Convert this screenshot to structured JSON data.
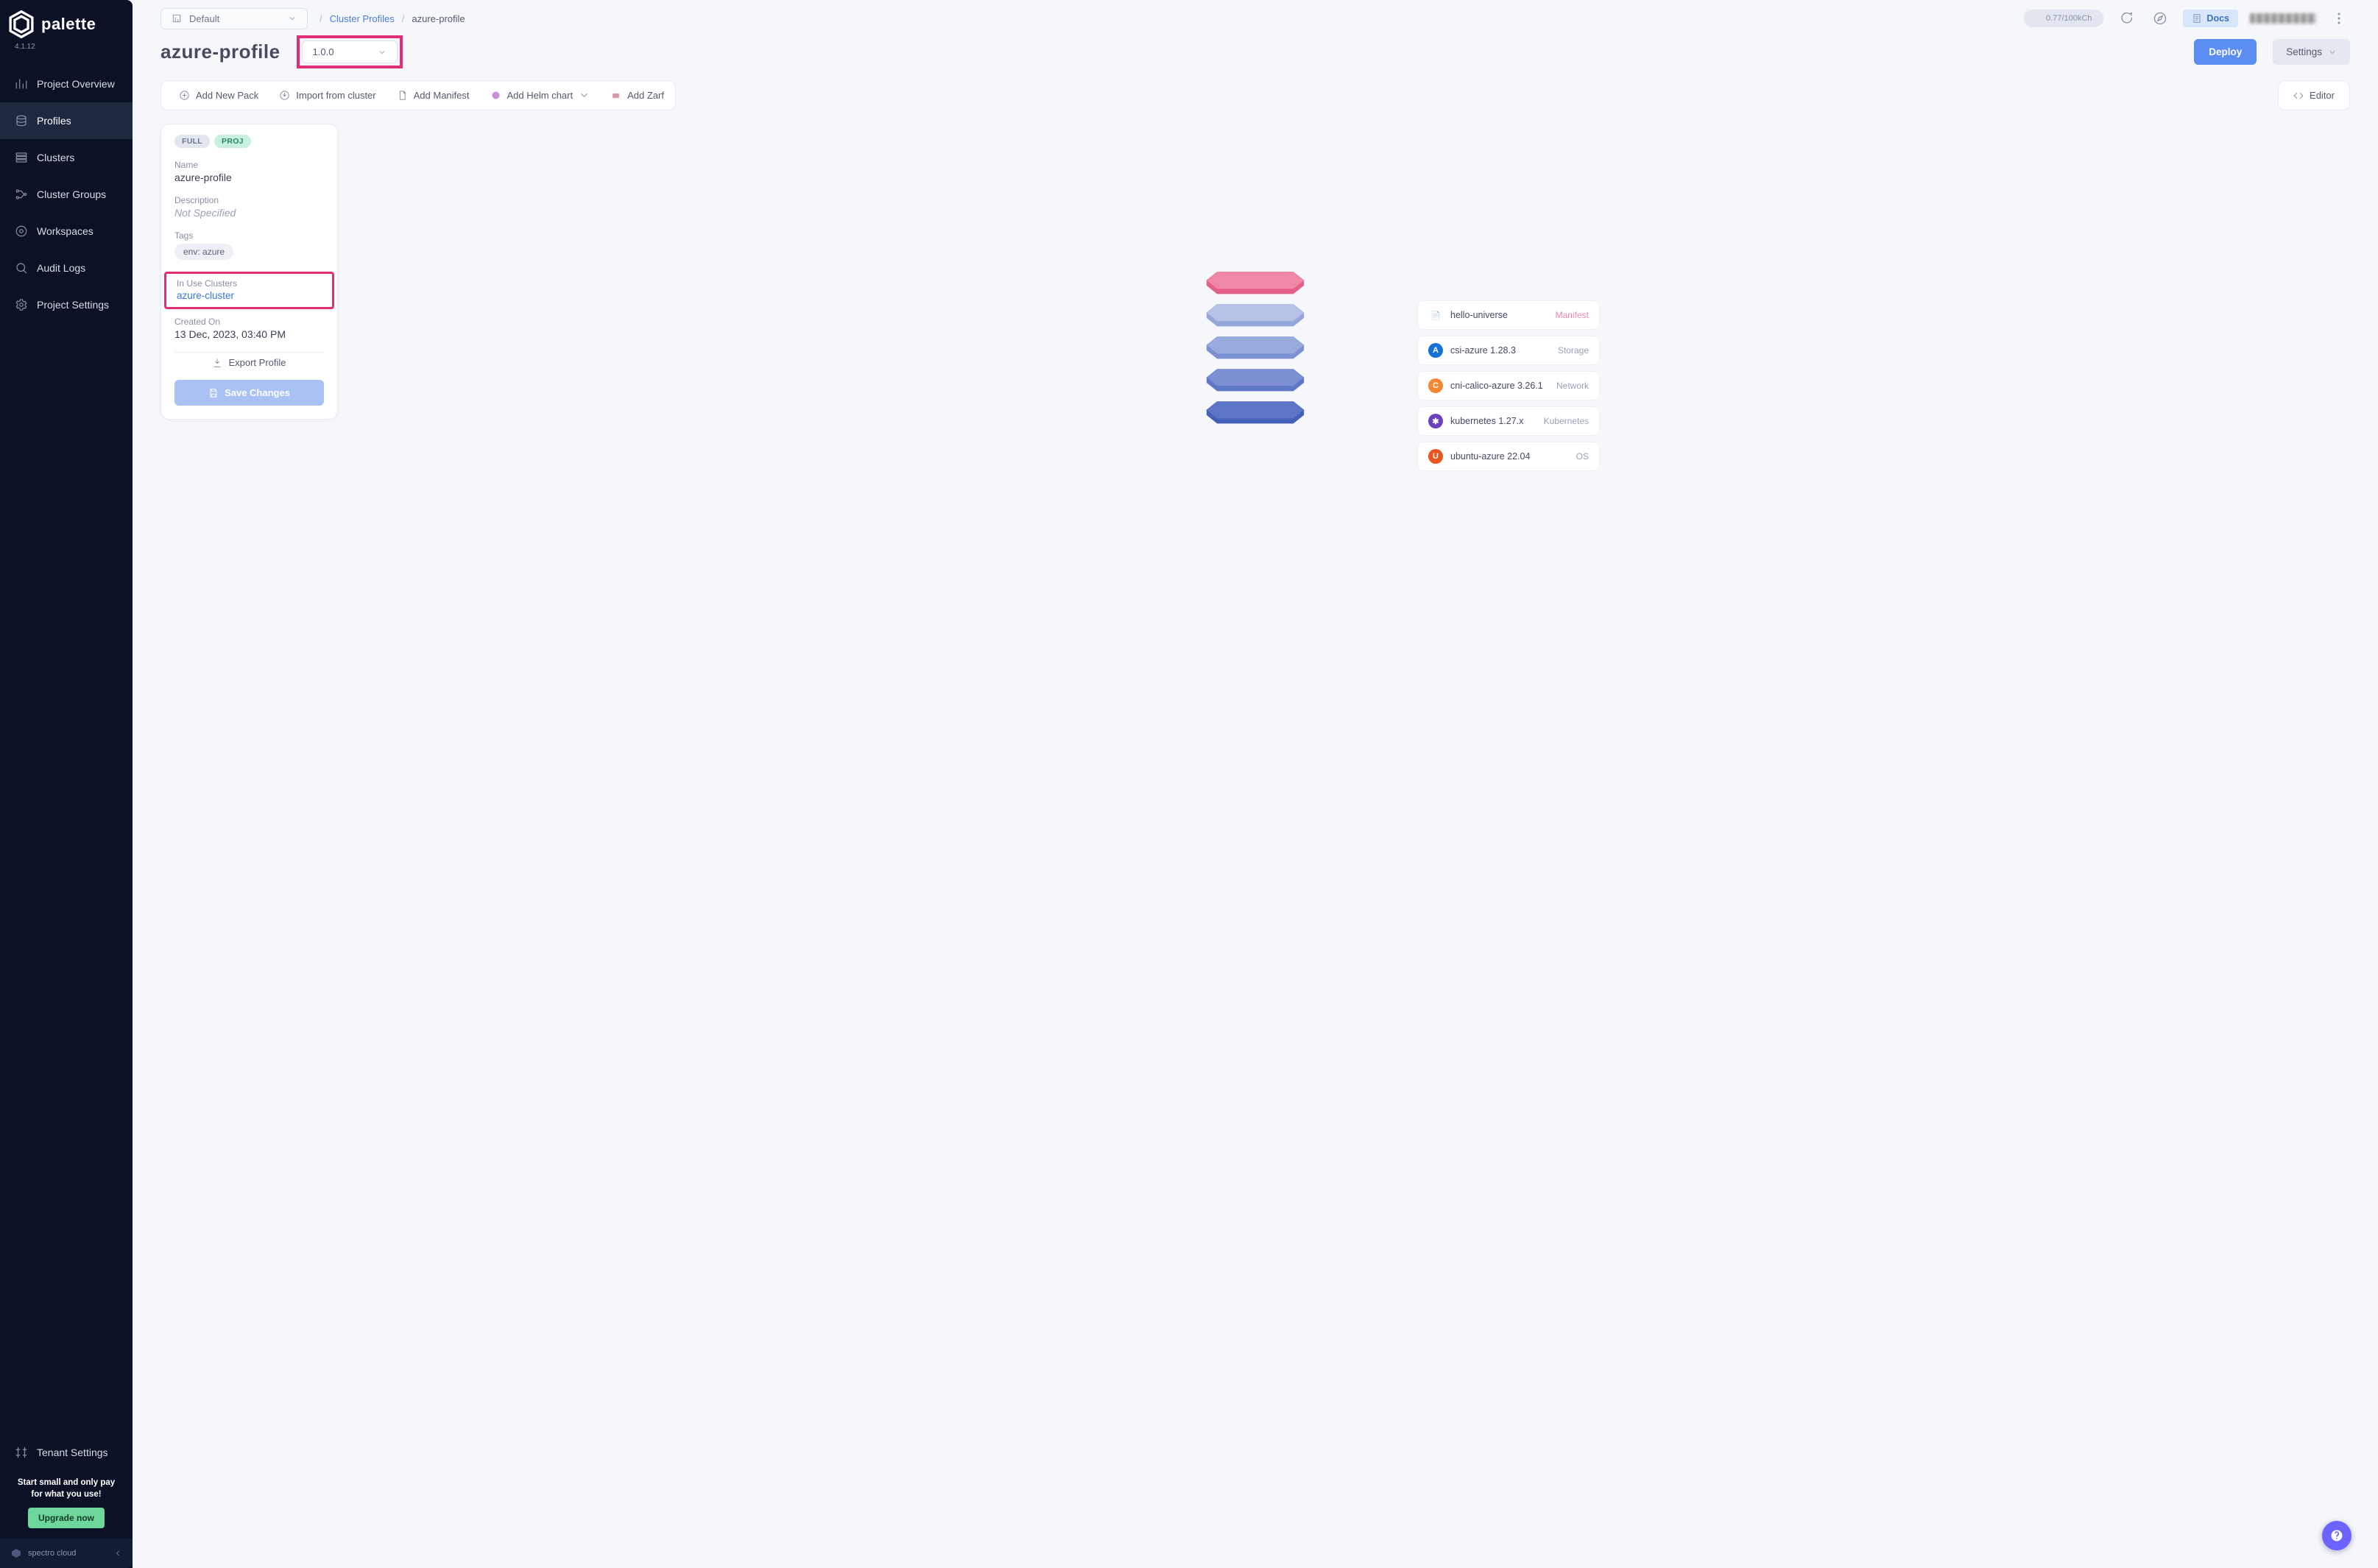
{
  "app": {
    "name": "palette",
    "version": "4.1.12"
  },
  "sidebar": {
    "items": [
      {
        "label": "Project Overview"
      },
      {
        "label": "Profiles"
      },
      {
        "label": "Clusters"
      },
      {
        "label": "Cluster Groups"
      },
      {
        "label": "Workspaces"
      },
      {
        "label": "Audit Logs"
      },
      {
        "label": "Project Settings"
      },
      {
        "label": "Tenant Settings"
      }
    ],
    "upgrade": {
      "line1": "Start small and only pay",
      "line2": "for what you use!",
      "button": "Upgrade now"
    },
    "brand": "spectro cloud"
  },
  "topbar": {
    "project": "Default",
    "breadcrumb": {
      "link": "Cluster Profiles",
      "current": "azure-profile"
    },
    "usage": "0.77/100kCh",
    "docs": "Docs"
  },
  "page": {
    "title": "azure-profile",
    "version": "1.0.0",
    "deploy": "Deploy",
    "settings": "Settings"
  },
  "toolbar": {
    "add_pack": "Add New Pack",
    "import": "Import from cluster",
    "manifest": "Add Manifest",
    "helm": "Add Helm chart",
    "zarf": "Add Zarf",
    "editor": "Editor"
  },
  "card": {
    "badges": {
      "full": "FULL",
      "proj": "PROJ"
    },
    "name_label": "Name",
    "name": "azure-profile",
    "desc_label": "Description",
    "desc": "Not Specified",
    "tags_label": "Tags",
    "tag": "env: azure",
    "inuse_label": "In Use Clusters",
    "inuse_link": "azure-cluster",
    "created_label": "Created On",
    "created": "13 Dec, 2023, 03:40 PM",
    "export": "Export Profile",
    "save": "Save Changes"
  },
  "layers": [
    {
      "title": "hello-universe",
      "kind": "Manifest",
      "color": "#ef88a6",
      "edge": "#e45f86",
      "icon_bg": "#fff",
      "glyph": "📄"
    },
    {
      "title": "csi-azure 1.28.3",
      "kind": "Storage",
      "color": "#b7c3e6",
      "edge": "#94a6da",
      "icon_bg": "#1572d4",
      "glyph": "A"
    },
    {
      "title": "cni-calico-azure 3.26.1",
      "kind": "Network",
      "color": "#99aadf",
      "edge": "#7c91d4",
      "icon_bg": "#f58634",
      "glyph": "C"
    },
    {
      "title": "kubernetes 1.27.x",
      "kind": "Kubernetes",
      "color": "#7b8fd2",
      "edge": "#5f77c7",
      "icon_bg": "#6b3fbf",
      "glyph": "✱"
    },
    {
      "title": "ubuntu-azure 22.04",
      "kind": "OS",
      "color": "#5d75c6",
      "edge": "#4560b9",
      "icon_bg": "#e95420",
      "glyph": "U"
    }
  ]
}
